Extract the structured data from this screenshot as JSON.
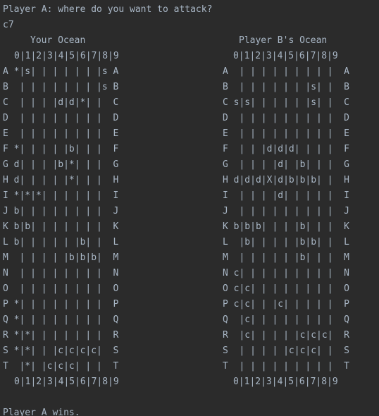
{
  "console": {
    "prompt": "Player A: where do you want to attack?",
    "user_input": "c7",
    "result": "Player A wins."
  },
  "boards": {
    "left": {
      "title": "Your Ocean",
      "header": "0|1|2|3|4|5|6|7|8|9",
      "footer": "0|1|2|3|4|5|6|7|8|9",
      "rows": [
        "A *|s| | | | | | |s A",
        "B  | | | | | | | |s B",
        "C  | | | |d|d|*| |  C",
        "D  | | | | | | | |  D",
        "E  | | | | | | | |  E",
        "F *| | | | |b| | |  F",
        "G d| | | |b|*| | |  G",
        "H d| | | | |*| | |  H",
        "I *|*|*| | | | | |  I",
        "J b| | | | | | | |  J",
        "K b|b| | | | | | |  K",
        "L b| | | | | |b| |  L",
        "M  | | | | |b|b|b|  M",
        "N  | | | | | | | |  N",
        "O  | | | | | | | |  O",
        "P *| | | | | | | |  P",
        "Q *| | | | | | | |  Q",
        "R *|*| | | | | | |  R",
        "S *|*| | |c|c|c|c|  S",
        "T  |*| |c|c|c| | |  T"
      ]
    },
    "right": {
      "title": "Player B's Ocean",
      "header": "0|1|2|3|4|5|6|7|8|9",
      "footer": "0|1|2|3|4|5|6|7|8|9",
      "rows": [
        "A  | | | | | | | | |  A",
        "B  | | | | | | |s| |  B",
        "C s|s| | | | | |s| |  C",
        "D  | | | | | | | | |  D",
        "E  | | | | | | | | |  E",
        "F  | | |d|d|d| | | |  F",
        "G  | | | |d| |b| | |  G",
        "H d|d|d|X|d|b|b|b| |  H",
        "I  | | | |d| | | | |  I",
        "J  | | | | | | | | |  J",
        "K b|b|b| | | |b| | |  K",
        "L  |b| | | | |b|b| |  L",
        "M  | | | | | |b| | |  M",
        "N c| | | | | | | | |  N",
        "O c|c| | | | | | | |  O",
        "P c|c| | |c| | | | |  P",
        "Q  |c| | | | | | | |  Q",
        "R  |c| | | | |c|c|c|  R",
        "S  | | | | |c|c|c| |  S",
        "T  | | | | | | | | |  T"
      ]
    }
  }
}
